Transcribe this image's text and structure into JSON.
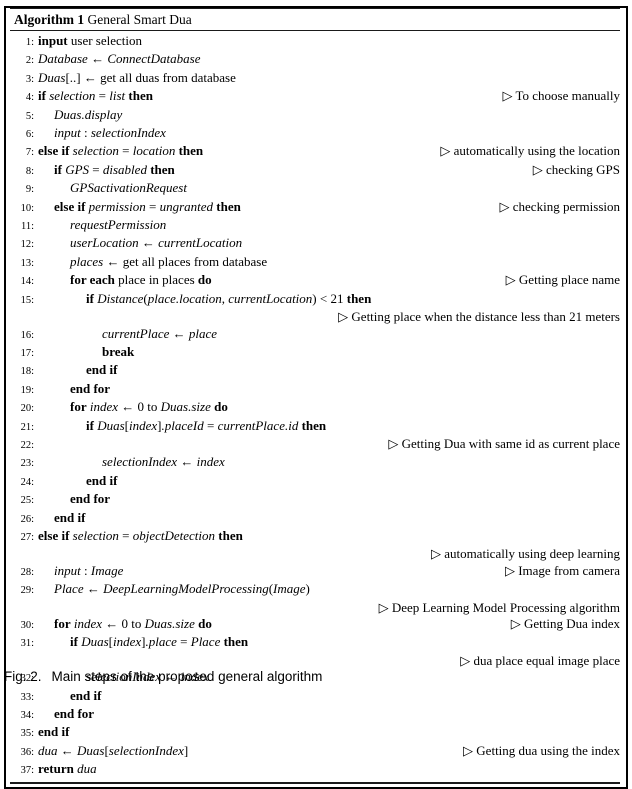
{
  "algorithm": {
    "header_label": "Algorithm 1",
    "header_title": "General Smart Dua",
    "comment_marker": "▷",
    "lines": [
      {
        "num": "1:",
        "indent": 0,
        "code_html": "<span class=\"kw\">input</span> <span class=\"rm\">user selection</span>",
        "code_text": "input user selection",
        "comment": ""
      },
      {
        "num": "2:",
        "indent": 0,
        "code_html": "<span class=\"var\">Database</span> <span class=\"rm\">&#8592;</span> <span class=\"var\">ConnectDatabase</span>",
        "code_text": "Database ← ConnectDatabase",
        "comment": ""
      },
      {
        "num": "3:",
        "indent": 0,
        "code_html": "<span class=\"var\">Duas</span><span class=\"rm\">[..]</span> <span class=\"rm\">&#8592;</span> <span class=\"rm\">get all duas from database</span>",
        "code_text": "Duas[..] ← get all duas from database",
        "comment": ""
      },
      {
        "num": "4:",
        "indent": 0,
        "code_html": "<span class=\"kw\">if</span> <span class=\"var\">selection</span> <span class=\"rm\">=</span> <span class=\"var\">list</span> <span class=\"kw\">then</span>",
        "code_text": "if selection = list then",
        "comment": "To choose manually"
      },
      {
        "num": "5:",
        "indent": 1,
        "code_html": "<span class=\"var\">Duas.display</span>",
        "code_text": "Duas.display",
        "comment": ""
      },
      {
        "num": "6:",
        "indent": 1,
        "code_html": "<span class=\"var\">input</span> <span class=\"rm\">:</span> <span class=\"var\">selectionIndex</span>",
        "code_text": "input : selectionIndex",
        "comment": ""
      },
      {
        "num": "7:",
        "indent": 0,
        "code_html": "<span class=\"kw\">else if</span> <span class=\"var\">selection</span> <span class=\"rm\">=</span> <span class=\"var\">location</span> <span class=\"kw\">then</span>",
        "code_text": "else if selection = location then",
        "comment": "automatically using the location"
      },
      {
        "num": "8:",
        "indent": 1,
        "code_html": "<span class=\"kw\">if</span> <span class=\"var\">GPS</span> <span class=\"rm\">=</span> <span class=\"var\">disabled</span> <span class=\"kw\">then</span>",
        "code_text": "if GPS = disabled then",
        "comment": "checking GPS"
      },
      {
        "num": "9:",
        "indent": 2,
        "code_html": "<span class=\"var\">GPSactivationRequest</span>",
        "code_text": "GPSactivationRequest",
        "comment": ""
      },
      {
        "num": "10:",
        "indent": 1,
        "code_html": "<span class=\"kw\">else if</span> <span class=\"var\">permission</span> <span class=\"rm\">=</span> <span class=\"var\">ungranted</span> <span class=\"kw\">then</span>",
        "code_text": "else if permission = ungranted then",
        "comment": "checking permission"
      },
      {
        "num": "11:",
        "indent": 2,
        "code_html": "<span class=\"var\">requestPermission</span>",
        "code_text": "requestPermission",
        "comment": ""
      },
      {
        "num": "12:",
        "indent": 2,
        "code_html": "<span class=\"var\">userLocation</span> <span class=\"rm\">&#8592;</span> <span class=\"var\">currentLocation</span>",
        "code_text": "userLocation ← currentLocation",
        "comment": ""
      },
      {
        "num": "13:",
        "indent": 2,
        "code_html": "<span class=\"var\">places</span> <span class=\"rm\">&#8592;</span> <span class=\"rm\">get all places from database</span>",
        "code_text": "places ← get all places from database",
        "comment": ""
      },
      {
        "num": "14:",
        "indent": 2,
        "code_html": "<span class=\"kw\">for each</span> <span class=\"rm\">place in places</span> <span class=\"kw\">do</span>",
        "code_text": "for each place in places do",
        "comment": "Getting place name"
      },
      {
        "num": "15:",
        "indent": 3,
        "code_html": "<span class=\"kw\">if</span> <span class=\"var\">Distance</span><span class=\"rm\">(</span><span class=\"var\">place.location</span><span class=\"rm\">,</span> <span class=\"var\">currentLocation</span><span class=\"rm\">)</span> <span class=\"rm\">&lt; 21</span> <span class=\"kw\">then</span>",
        "code_text": "if Distance(place.location, currentLocation) < 21 then",
        "comment": ""
      },
      {
        "num": "",
        "indent": 0,
        "continuation": true,
        "code_html": "",
        "code_text": "",
        "comment": "Getting place when the distance less than 21 meters"
      },
      {
        "num": "16:",
        "indent": 4,
        "code_html": "<span class=\"var\">currentPlace</span> <span class=\"rm\">&#8592;</span> <span class=\"var\">place</span>",
        "code_text": "currentPlace ← place",
        "comment": ""
      },
      {
        "num": "17:",
        "indent": 4,
        "code_html": "<span class=\"kw\">break</span>",
        "code_text": "break",
        "comment": ""
      },
      {
        "num": "18:",
        "indent": 3,
        "code_html": "<span class=\"kw\">end if</span>",
        "code_text": "end if",
        "comment": ""
      },
      {
        "num": "19:",
        "indent": 2,
        "code_html": "<span class=\"kw\">end for</span>",
        "code_text": "end for",
        "comment": ""
      },
      {
        "num": "20:",
        "indent": 2,
        "code_html": "<span class=\"kw\">for</span> <span class=\"var\">index</span> <span class=\"rm\">&#8592; 0</span> <span class=\"rm\">to</span> <span class=\"var\">Duas.size</span> <span class=\"kw\">do</span>",
        "code_text": "for index ← 0 to Duas.size do",
        "comment": ""
      },
      {
        "num": "21:",
        "indent": 3,
        "code_html": "<span class=\"kw\">if</span> <span class=\"var\">Duas</span><span class=\"rm\">[</span><span class=\"var\">index</span><span class=\"rm\">]</span><span class=\"var\">.placeId</span> <span class=\"rm\">=</span> <span class=\"var\">currentPlace.id</span> <span class=\"kw\">then</span>",
        "code_text": "if Duas[index].placeId = currentPlace.id then",
        "comment": ""
      },
      {
        "num": "22:",
        "indent": 0,
        "continuation": true,
        "code_html": "",
        "code_text": "",
        "comment": "Getting Dua with same id as current place"
      },
      {
        "num": "23:",
        "indent": 4,
        "code_html": "<span class=\"var\">selectionIndex</span> <span class=\"rm\">&#8592;</span> <span class=\"var\">index</span>",
        "code_text": "selectionIndex ← index",
        "comment": ""
      },
      {
        "num": "24:",
        "indent": 3,
        "code_html": "<span class=\"kw\">end if</span>",
        "code_text": "end if",
        "comment": ""
      },
      {
        "num": "25:",
        "indent": 2,
        "code_html": "<span class=\"kw\">end for</span>",
        "code_text": "end for",
        "comment": ""
      },
      {
        "num": "26:",
        "indent": 1,
        "code_html": "<span class=\"kw\">end if</span>",
        "code_text": "end if",
        "comment": ""
      },
      {
        "num": "27:",
        "indent": 0,
        "code_html": "<span class=\"kw\">else if</span> <span class=\"var\">selection</span> <span class=\"rm\">=</span> <span class=\"var\">objectDetection</span> <span class=\"kw\">then</span>",
        "code_text": "else if selection = objectDetection then",
        "comment": ""
      },
      {
        "num": "",
        "indent": 0,
        "continuation": true,
        "code_html": "",
        "code_text": "",
        "comment": "automatically using deep learning"
      },
      {
        "num": "28:",
        "indent": 1,
        "code_html": "<span class=\"var\">input</span> <span class=\"rm\">:</span> <span class=\"var\">Image</span>",
        "code_text": "input : Image",
        "comment": "Image from camera"
      },
      {
        "num": "29:",
        "indent": 1,
        "code_html": "<span class=\"var\">Place</span> <span class=\"rm\">&#8592;</span> <span class=\"var\">DeepLearningModelProcessing</span><span class=\"rm\">(</span><span class=\"var\">Image</span><span class=\"rm\">)</span>",
        "code_text": "Place ← DeepLearningModelProcessing(Image)",
        "comment": ""
      },
      {
        "num": "",
        "indent": 0,
        "continuation": true,
        "code_html": "",
        "code_text": "",
        "comment": "Deep Learning Model Processing algorithm"
      },
      {
        "num": "30:",
        "indent": 1,
        "code_html": "<span class=\"kw\">for</span> <span class=\"var\">index</span> <span class=\"rm\">&#8592; 0</span> <span class=\"rm\">to</span> <span class=\"var\">Duas.size</span> <span class=\"kw\">do</span>",
        "code_text": "for index ← 0 to Duas.size do",
        "comment": "Getting Dua index"
      },
      {
        "num": "31:",
        "indent": 2,
        "code_html": "<span class=\"kw\">if</span> <span class=\"var\">Duas</span><span class=\"rm\">[</span><span class=\"var\">index</span><span class=\"rm\">]</span><span class=\"var\">.place</span> <span class=\"rm\">=</span> <span class=\"var\">Place</span> <span class=\"kw\">then</span>",
        "code_text": "if Duas[index].place = Place then",
        "comment": ""
      },
      {
        "num": "",
        "indent": 0,
        "continuation": true,
        "code_html": "",
        "code_text": "",
        "comment": "dua place equal image place"
      },
      {
        "num": "32:",
        "indent": 3,
        "code_html": "<span class=\"var\">selectionIndex</span> <span class=\"rm\">&#8592;</span> <span class=\"var\">index</span>",
        "code_text": "selectionIndex ← index",
        "comment": ""
      },
      {
        "num": "33:",
        "indent": 2,
        "code_html": "<span class=\"kw\">end if</span>",
        "code_text": "end if",
        "comment": ""
      },
      {
        "num": "34:",
        "indent": 1,
        "code_html": "<span class=\"kw\">end for</span>",
        "code_text": "end for",
        "comment": ""
      },
      {
        "num": "35:",
        "indent": 0,
        "code_html": "<span class=\"kw\">end if</span>",
        "code_text": "end if",
        "comment": ""
      },
      {
        "num": "36:",
        "indent": 0,
        "code_html": "<span class=\"var\">dua</span> <span class=\"rm\">&#8592;</span> <span class=\"var\">Duas</span><span class=\"rm\">[</span><span class=\"var\">selectionIndex</span><span class=\"rm\">]</span>",
        "code_text": "dua ← Duas[selectionIndex]",
        "comment": "Getting dua using the index"
      },
      {
        "num": "37:",
        "indent": 0,
        "code_html": "<span class=\"kw\">return</span> <span class=\"var\">dua</span>",
        "code_text": "return dua",
        "comment": ""
      }
    ]
  },
  "figure": {
    "label": "Fig. 2.",
    "caption": "Main steps of the proposed general algorithm"
  }
}
